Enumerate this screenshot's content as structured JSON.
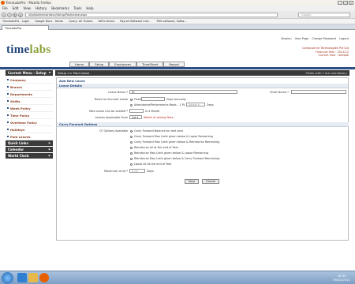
{
  "browser": {
    "window_title": "TimeLabsPro - Mozilla Firefox",
    "menu": [
      "File",
      "Edit",
      "View",
      "History",
      "Bookmarks",
      "Tools",
      "Help"
    ],
    "url": "ufpd/Administration/Setup/PaidLeave.aspx",
    "search_placeholder": "Google",
    "bookmarks": [
      "TimelabsPro - Login",
      "Google Docs - Home",
      "Query: All Tickets",
      "ToPro Demo",
      "Payroll Software Indi...",
      "TDS software, Softw..."
    ],
    "tab_title": "TimelabsPro"
  },
  "header": {
    "logo_main": "time",
    "logo_accent": "labs",
    "top_links": [
      "Session",
      "User Page",
      "Change Password",
      "Logout"
    ],
    "company_lines": [
      "Compuserve Technologies Pvt Ltd",
      "Financial Year : 2011/12",
      "Current User : deepak"
    ],
    "main_nav": [
      "Home",
      "Setup",
      "Employees",
      "TimeSheet",
      "Report"
    ]
  },
  "sidebar": {
    "current_menu": "Current Menu - Setup",
    "items": [
      "Company",
      "Branch",
      "Departments",
      "Shifts",
      "Week Policy",
      "Time Policy",
      "Overtime Policy",
      "Holidays",
      "Paid Leaves"
    ],
    "sections": [
      "Quick Links",
      "Calendar",
      "World Clock"
    ]
  },
  "breadcrumb": {
    "left": "Setup >> Paid Leave",
    "right": "Fields with * are mandatory"
  },
  "form": {
    "title": "Add New Leave",
    "leave_details": "Leave Details",
    "leave_name_label": "Leave Name *",
    "leave_name_value": "PL",
    "short_name_label": "Short Name *",
    "accrued_rules_label": "Rules for Accrued Leave",
    "fixed_label": "Fixed",
    "fixed_suffix": "Days annually",
    "attendance_label": "Attendance/Performance Basis - 1 PL -",
    "attendance_select": "Select",
    "attendance_suffix": "Days",
    "max_leave_label": "Max Leave Can be availed *",
    "max_leave_suffix": "in a Month",
    "applicable_label": "Leaves Applicable From",
    "applicable_value": "1st",
    "applicable_suffix": "Month of Joining Date",
    "carry_forward_title": "Carry Forward Options",
    "cf_options_label": "CF Options Available",
    "cf_options": [
      "Carry Forward Balance to next year",
      "Carry Forward Max Limit given below & Lapse Remaining",
      "Carry Forward Max Limit given below & Reimburse Remaining",
      "Reimburse all at the end of Year",
      "Reimburse Max Limit given below & Lapse Remaining",
      "Reimburse Max Limit given below & Carry Forward Remaining",
      "Lapse all at the end of Year"
    ],
    "maximum_limit_label": "Maximum Limit *",
    "maximum_limit_value": "0.00",
    "maximum_limit_suffix": "Days",
    "save_label": "Save",
    "cancel_label": "Cancel"
  },
  "taskbar": {
    "time": "16:30",
    "date": "09/02/2011"
  },
  "colors": {
    "brand_blue": "#2b4f82",
    "sidebar_link": "#8a3b1f",
    "header_dark": "#3a3a3a"
  }
}
